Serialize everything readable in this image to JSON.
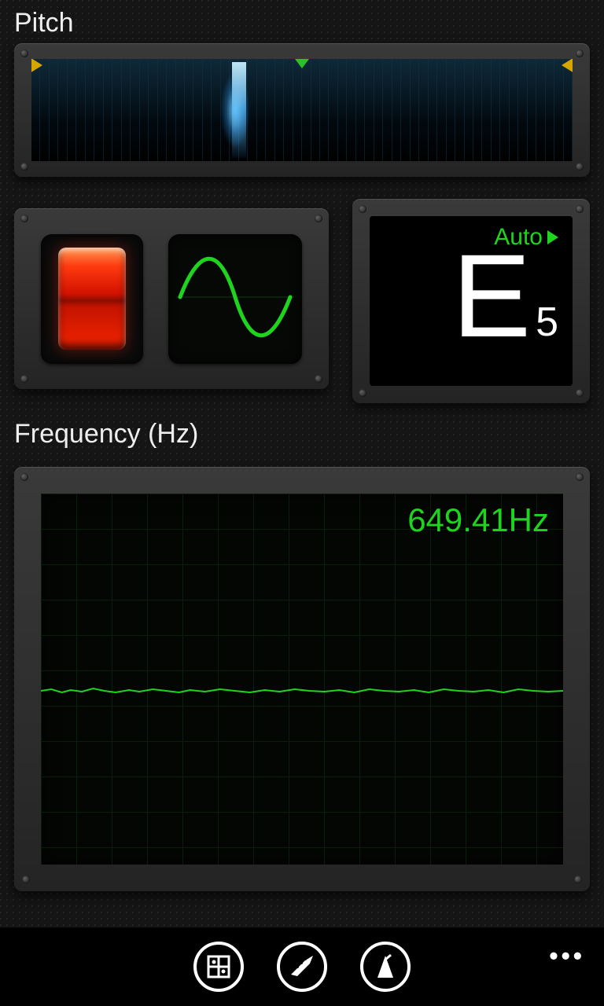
{
  "pitch": {
    "label": "Pitch",
    "indicator_position_pct": 36
  },
  "controls": {
    "power_on": true,
    "wave_mode": "sine"
  },
  "note_display": {
    "mode_label": "Auto",
    "note_letter": "E",
    "octave": "5"
  },
  "frequency": {
    "label": "Frequency (Hz)",
    "readout": "649.41Hz",
    "value_hz": 649.41
  },
  "appbar": {
    "buttons": [
      "tuner-mode",
      "guitar-mode",
      "metronome-mode"
    ],
    "more": "•••"
  },
  "colors": {
    "accent_green": "#1fd41f",
    "power_red": "#e82000",
    "marker_amber": "#d6a500"
  }
}
